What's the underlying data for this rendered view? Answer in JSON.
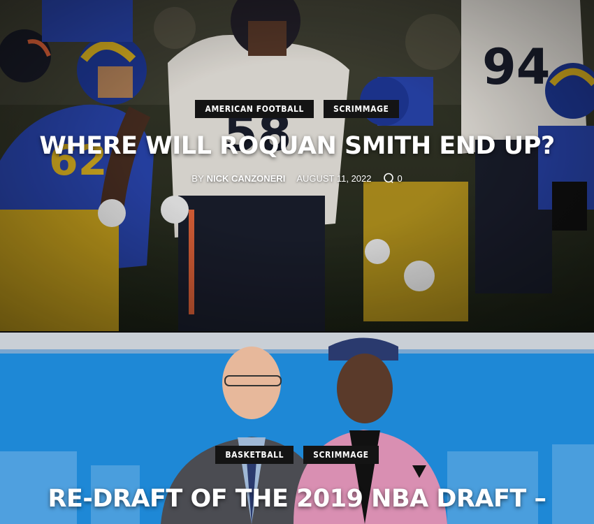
{
  "posts": [
    {
      "categories": [
        "AMERICAN FOOTBALL",
        "SCRIMMAGE"
      ],
      "title": "WHERE WILL ROQUAN SMITH END UP?",
      "by": "BY",
      "author": "NICK CANZONERI",
      "date": "AUGUST 11, 2022",
      "comments": "0"
    },
    {
      "categories": [
        "BASKETBALL",
        "SCRIMMAGE"
      ],
      "title": "RE-DRAFT OF THE 2019 NBA DRAFT –"
    }
  ],
  "colors": {
    "tag_background": "#141414",
    "text": "#ffffff",
    "rams_blue": "#2a47b3",
    "rams_gold": "#e1b722",
    "bears_navy": "#1b1f2e",
    "bears_orange": "#e8663b",
    "nba_blue": "#1e88d6",
    "suit_pink": "#d98fb2"
  },
  "icons": [
    "comment-icon"
  ]
}
